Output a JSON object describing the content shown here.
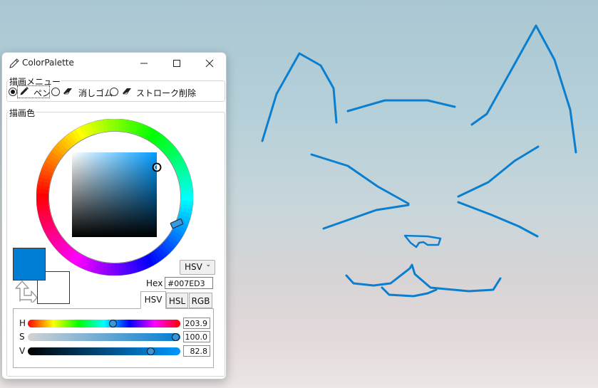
{
  "window": {
    "title": "ColorPalette",
    "minimize_icon": "minimize-icon",
    "maximize_icon": "maximize-icon",
    "close_icon": "close-icon"
  },
  "drawing_menu": {
    "label": "描画メニュー",
    "options": [
      {
        "label": "ペン",
        "icon": "pen-icon",
        "checked": true
      },
      {
        "label": "消しゴム",
        "icon": "eraser-icon",
        "checked": false
      },
      {
        "label": "ストローク削除",
        "icon": "eraser-icon",
        "checked": false
      }
    ]
  },
  "drawing_color": {
    "label": "描画色",
    "foreground_color": "#007ED3",
    "background_color": "#FFFFFF",
    "mode_select": "HSV",
    "hex_label": "Hex",
    "hex_value": "#007ED3",
    "tabs": [
      "HSV",
      "HSL",
      "RGB"
    ],
    "active_tab": "HSV",
    "sliders": [
      {
        "label": "H",
        "value": "203.9",
        "fraction": 0.566
      },
      {
        "label": "S",
        "value": "100.0",
        "fraction": 1.0
      },
      {
        "label": "V",
        "value": "82.8",
        "fraction": 0.828
      }
    ]
  },
  "stroke_color": "#0a7fd0"
}
